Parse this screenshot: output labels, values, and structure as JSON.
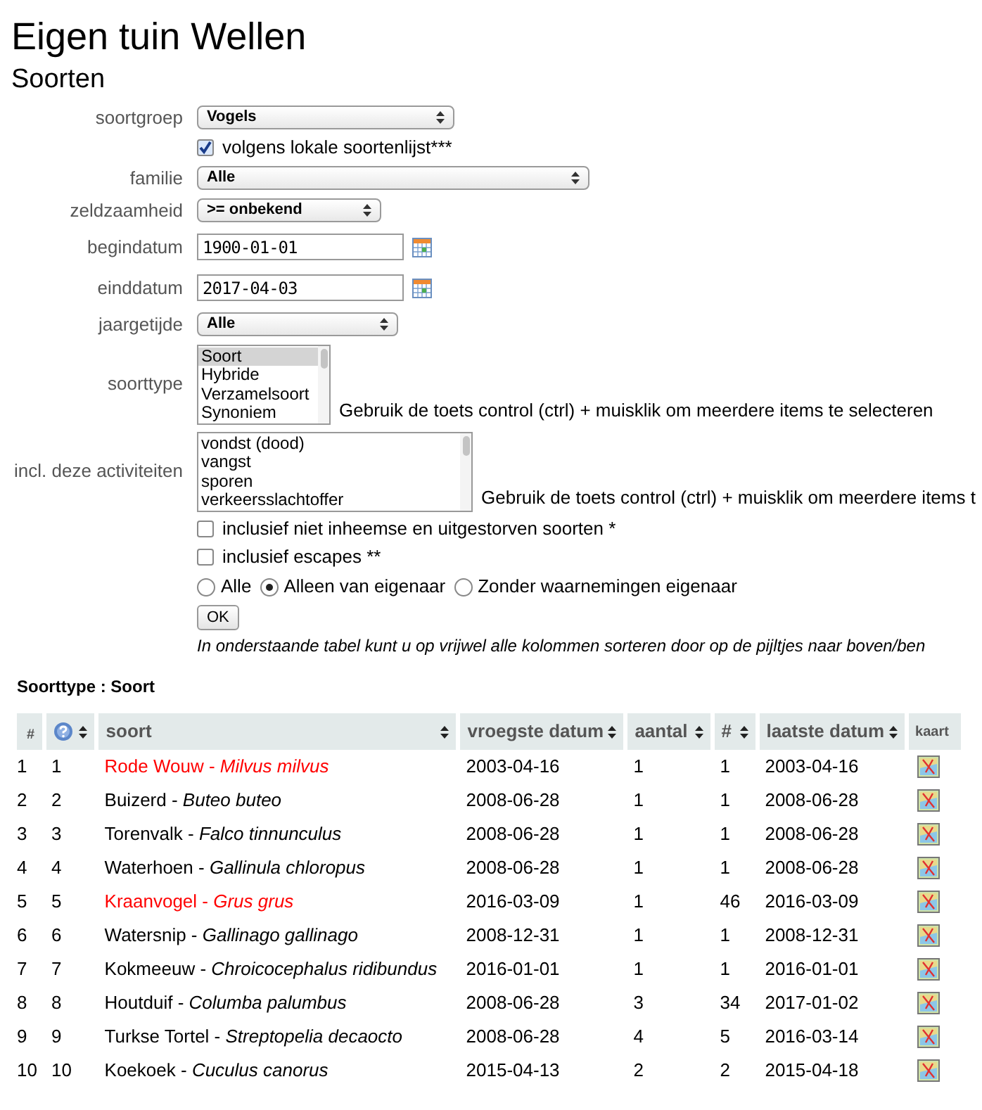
{
  "title": "Eigen tuin Wellen",
  "subtitle": "Soorten",
  "form": [
    {
      "kind": "select",
      "label": "soortgroep",
      "value": "Vogels"
    },
    {
      "kind": "checkbox",
      "label": "volgens lokale soortenlijst***",
      "checked": true
    },
    {
      "kind": "select",
      "label": "familie",
      "value": "Alle"
    },
    {
      "kind": "select",
      "label": "zeldzaamheid",
      "value": ">= onbekend"
    },
    {
      "kind": "date",
      "label": "begindatum",
      "value": "1900-01-01"
    },
    {
      "kind": "date",
      "label": "einddatum",
      "value": "2017-04-03"
    },
    {
      "kind": "select",
      "label": "jaargetijde",
      "value": "Alle"
    },
    {
      "kind": "list",
      "label": "soorttype",
      "hint": "Gebruik de toets control (ctrl) + muisklik om meerdere items te selecteren",
      "options": [
        {
          "text": "Soort",
          "selected": true
        },
        {
          "text": "Hybride",
          "selected": false
        },
        {
          "text": "Verzamelsoort",
          "selected": false
        },
        {
          "text": "Synoniem",
          "selected": false
        }
      ]
    },
    {
      "kind": "list",
      "label": "incl. deze activiteiten",
      "hint": "Gebruik de toets control (ctrl) + muisklik om meerdere items t",
      "options": [
        {
          "text": "vondst (dood)",
          "selected": false
        },
        {
          "text": "vangst",
          "selected": false
        },
        {
          "text": "sporen",
          "selected": false
        },
        {
          "text": "verkeersslachtoffer",
          "selected": false
        }
      ]
    },
    {
      "kind": "checkbox",
      "label": "inclusief niet inheemse en uitgestorven soorten *",
      "checked": false
    },
    {
      "kind": "checkbox",
      "label": "inclusief escapes **",
      "checked": false
    },
    {
      "kind": "radio",
      "options": [
        {
          "text": "Alle",
          "selected": false
        },
        {
          "text": "Alleen van eigenaar",
          "selected": true
        },
        {
          "text": "Zonder waarnemingen eigenaar",
          "selected": false
        }
      ]
    },
    {
      "kind": "button",
      "label": "OK"
    },
    {
      "kind": "note",
      "text": "In onderstaande tabel kunt u op vrijwel alle kolommen sorteren door op de pijltjes naar boven/ben"
    }
  ],
  "table": {
    "caption": "Soorttype : Soort",
    "columns": [
      {
        "label": "#",
        "sortable": false
      },
      {
        "kind": "icon",
        "sortable": true
      },
      {
        "label": "soort",
        "sortable": true
      },
      {
        "label": "vroegste datum",
        "sortable": true
      },
      {
        "label": "aantal",
        "sortable": true
      },
      {
        "label": "#",
        "sortable": true
      },
      {
        "label": "laatste datum",
        "sortable": true
      },
      {
        "label": "kaart",
        "sortable": false
      }
    ],
    "rows": [
      {
        "n": "1",
        "rank": "1",
        "soort": "Rode Wouw - *Milvus milvus*",
        "color": "#ff0000",
        "first": "2003-04-16",
        "aantal": "1",
        "count": "1",
        "last": "2003-04-16"
      },
      {
        "n": "2",
        "rank": "2",
        "soort": "Buizerd - *Buteo buteo*",
        "color": "#000000",
        "first": "2008-06-28",
        "aantal": "1",
        "count": "1",
        "last": "2008-06-28"
      },
      {
        "n": "3",
        "rank": "3",
        "soort": "Torenvalk - *Falco tinnunculus*",
        "color": "#000000",
        "first": "2008-06-28",
        "aantal": "1",
        "count": "1",
        "last": "2008-06-28"
      },
      {
        "n": "4",
        "rank": "4",
        "soort": "Waterhoen - *Gallinula chloropus*",
        "color": "#000000",
        "first": "2008-06-28",
        "aantal": "1",
        "count": "1",
        "last": "2008-06-28"
      },
      {
        "n": "5",
        "rank": "5",
        "soort": "Kraanvogel - *Grus grus*",
        "color": "#ff0000",
        "first": "2016-03-09",
        "aantal": "1",
        "count": "46",
        "last": "2016-03-09"
      },
      {
        "n": "6",
        "rank": "6",
        "soort": "Watersnip - *Gallinago gallinago*",
        "color": "#000000",
        "first": "2008-12-31",
        "aantal": "1",
        "count": "1",
        "last": "2008-12-31"
      },
      {
        "n": "7",
        "rank": "7",
        "soort": "Kokmeeuw - *Chroicocephalus ridibundus*",
        "color": "#000000",
        "first": "2016-01-01",
        "aantal": "1",
        "count": "1",
        "last": "2016-01-01"
      },
      {
        "n": "8",
        "rank": "8",
        "soort": "Houtduif - *Columba palumbus*",
        "color": "#000000",
        "first": "2008-06-28",
        "aantal": "3",
        "count": "34",
        "last": "2017-01-02"
      },
      {
        "n": "9",
        "rank": "9",
        "soort": "Turkse Tortel - *Streptopelia decaocto*",
        "color": "#000000",
        "first": "2008-06-28",
        "aantal": "4",
        "count": "5",
        "last": "2016-03-14"
      },
      {
        "n": "10",
        "rank": "10",
        "soort": "Koekoek - *Cuculus canorus*",
        "color": "#000000",
        "first": "2015-04-13",
        "aantal": "2",
        "count": "2",
        "last": "2015-04-18"
      }
    ]
  }
}
